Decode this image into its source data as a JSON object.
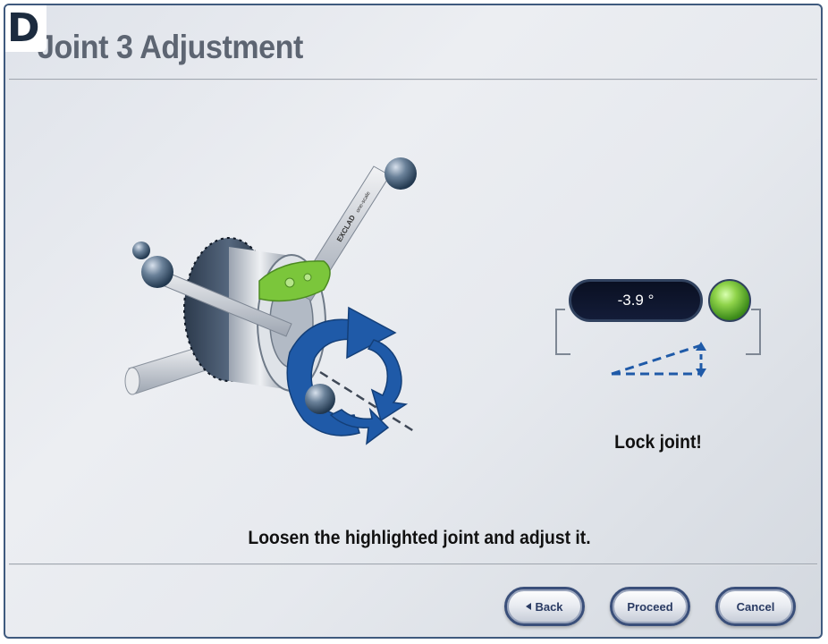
{
  "panel_label": "D",
  "title": "Joint 3 Adjustment",
  "readout": {
    "angle_value": "-3.9 °",
    "status_led_color": "#7cc43c"
  },
  "lock_message": "Lock joint!",
  "instruction": "Loosen the highlighted joint and adjust it.",
  "illustration": {
    "highlight_color": "#7bc63b",
    "arrow_color": "#1f5aa8",
    "strut_text_1": "EXCLAD",
    "strut_text_2": "one-scale"
  },
  "buttons": {
    "back": "Back",
    "proceed": "Proceed",
    "cancel": "Cancel"
  },
  "icons": {
    "back": "arrow-left-icon",
    "rotate": "rotation-arrows-icon",
    "angle": "angle-indicator-icon"
  }
}
